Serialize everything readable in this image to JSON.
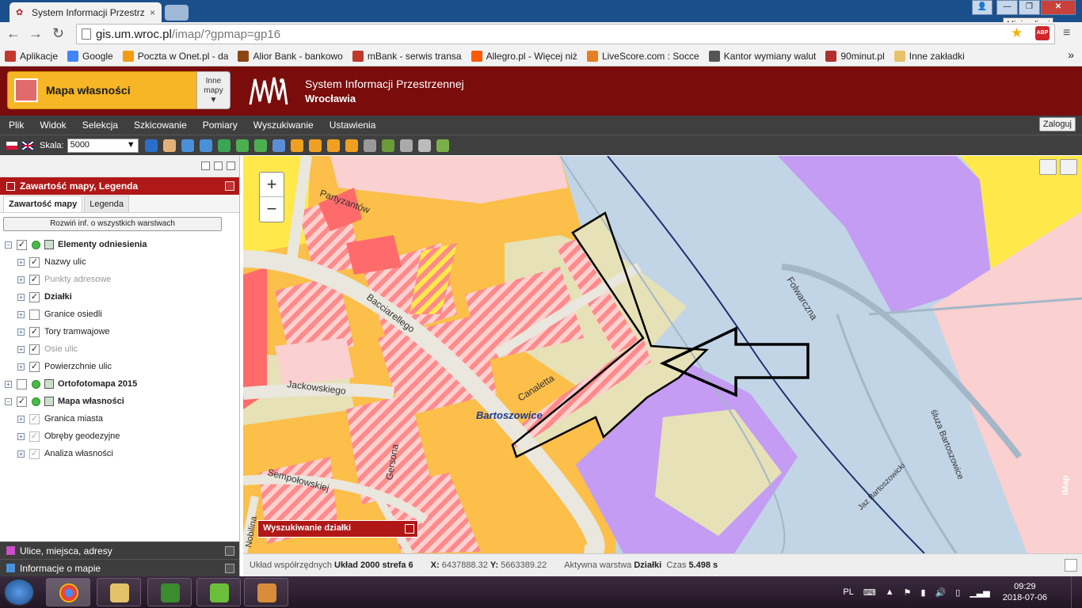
{
  "browser": {
    "tab_title": "System Informacji Przestrz",
    "tab_close": "×",
    "url_host": "gis.um.wroc.pl",
    "url_path": "/imap/?gpmap=gp16",
    "tooltip": "Minimalizuj",
    "abp": "ABP",
    "bookmarks": [
      {
        "label": "Aplikacje",
        "color": "#c0392b"
      },
      {
        "label": "Google",
        "color": "#4285f4"
      },
      {
        "label": "Poczta w Onet.pl - da",
        "color": "#f39c12"
      },
      {
        "label": "Alior Bank - bankowo",
        "color": "#8b4513"
      },
      {
        "label": "mBank - serwis transa",
        "color": "#c0392b"
      },
      {
        "label": "Allegro.pl - Więcej niż",
        "color": "#ff5a00"
      },
      {
        "label": "LiveScore.com : Socce",
        "color": "#e67e22"
      },
      {
        "label": "Kantor wymiany walut",
        "color": "#555555"
      },
      {
        "label": "90minut.pl",
        "color": "#b03030"
      },
      {
        "label": "Inne zakładki",
        "color": "#e8c16b"
      }
    ]
  },
  "header": {
    "map_name": "Mapa własności",
    "other_maps_1": "Inne",
    "other_maps_2": "mapy",
    "title_line1": "System Informacji Przestrzennej",
    "title_line2": "Wrocławia"
  },
  "menu": {
    "items": [
      "Plik",
      "Widok",
      "Selekcja",
      "Szkicowanie",
      "Pomiary",
      "Wyszukiwanie",
      "Ustawienia"
    ],
    "login": "Zaloguj"
  },
  "toolbar": {
    "scale_label": "Skala:",
    "scale_value": "5000",
    "scale_arrow": "▼",
    "icons": [
      {
        "name": "info-icon",
        "color": "#2a6fc9"
      },
      {
        "name": "pan-hand-icon",
        "color": "#e3b27a"
      },
      {
        "name": "zoom-in-icon",
        "color": "#4a90d9"
      },
      {
        "name": "zoom-out-icon",
        "color": "#4a90d9"
      },
      {
        "name": "globe-icon",
        "color": "#3aa655"
      },
      {
        "name": "back-arrow-icon",
        "color": "#4caf50"
      },
      {
        "name": "forward-arrow-icon",
        "color": "#4caf50"
      },
      {
        "name": "zoom-box-icon",
        "color": "#5b8ed6"
      },
      {
        "name": "pencil-icon",
        "color": "#f0a020"
      },
      {
        "name": "measure-line-icon",
        "color": "#f0a020"
      },
      {
        "name": "measure-area-icon",
        "color": "#f0a020"
      },
      {
        "name": "crop-icon",
        "color": "#f0a020"
      },
      {
        "name": "layers-icon",
        "color": "#999999"
      },
      {
        "name": "wfs-icon",
        "color": "#6a9a3a"
      },
      {
        "name": "print-icon",
        "color": "#aaaaaa"
      },
      {
        "name": "link-icon",
        "color": "#bbbbbb"
      },
      {
        "name": "image-export-icon",
        "color": "#7ab04a"
      }
    ]
  },
  "left_panel": {
    "section_title": "Zawartość mapy, Legenda",
    "tabs": [
      "Zawartość mapy",
      "Legenda"
    ],
    "expand_all": "Rozwiń inf. o wszystkich warstwach",
    "layers": [
      {
        "label": "Elementy odniesienia",
        "level": 0,
        "checked": true,
        "bold": true,
        "dot": true,
        "icon": true,
        "dim": false,
        "pm": "−"
      },
      {
        "label": "Nazwy ulic",
        "level": 1,
        "checked": true,
        "bold": false,
        "dot": false,
        "icon": false,
        "dim": false,
        "pm": "+"
      },
      {
        "label": "Punkty adresowe",
        "level": 1,
        "checked": true,
        "bold": false,
        "dot": false,
        "icon": false,
        "dim": true,
        "pm": "+"
      },
      {
        "label": "Działki",
        "level": 1,
        "checked": true,
        "bold": true,
        "dot": false,
        "icon": false,
        "dim": false,
        "pm": "+"
      },
      {
        "label": "Granice osiedli",
        "level": 1,
        "checked": false,
        "bold": false,
        "dot": false,
        "icon": false,
        "dim": false,
        "pm": "+"
      },
      {
        "label": "Tory tramwajowe",
        "level": 1,
        "checked": true,
        "bold": false,
        "dot": false,
        "icon": false,
        "dim": false,
        "pm": "+"
      },
      {
        "label": "Osie ulic",
        "level": 1,
        "checked": true,
        "bold": false,
        "dot": false,
        "icon": false,
        "dim": true,
        "pm": "+"
      },
      {
        "label": "Powierzchnie ulic",
        "level": 1,
        "checked": true,
        "bold": false,
        "dot": false,
        "icon": false,
        "dim": false,
        "pm": "+"
      },
      {
        "label": "Ortofotomapa 2015",
        "level": 0,
        "checked": false,
        "bold": true,
        "dot": true,
        "icon": true,
        "dim": false,
        "pm": "+"
      },
      {
        "label": "Mapa własności",
        "level": 0,
        "checked": true,
        "bold": true,
        "dot": true,
        "icon": true,
        "dim": false,
        "pm": "−"
      },
      {
        "label": "Granica miasta",
        "level": 1,
        "checked": true,
        "bold": false,
        "dot": false,
        "icon": false,
        "dim": false,
        "pm": "+",
        "disabled": true
      },
      {
        "label": "Obręby geodezyjne",
        "level": 1,
        "checked": true,
        "bold": false,
        "dot": false,
        "icon": false,
        "dim": false,
        "pm": "+",
        "disabled": true
      },
      {
        "label": "Analiza własności",
        "level": 1,
        "checked": true,
        "bold": false,
        "dot": false,
        "icon": false,
        "dim": false,
        "pm": "+",
        "disabled": true
      }
    ],
    "bottom_sections": [
      "Ulice, miejsca, adresy",
      "Informacje o mapie"
    ]
  },
  "map": {
    "zoom_in": "+",
    "zoom_out": "−",
    "search_panel": "Wyszukiwanie działki",
    "district_label": "Bartoszowice",
    "imap_logo": "iMap",
    "street_labels": [
      "Partyzantów",
      "Bacciarellego",
      "Canaletta",
      "Jackowskiego",
      "Sempołowskiej",
      "Gersona",
      "Folwarczna",
      "śluza Bartoszowice",
      "Jaz Bartoszowicki",
      "Nobilina"
    ]
  },
  "status": {
    "coord_label": "Układ współrzędnych",
    "coord_value": "Układ 2000 strefa 6",
    "x_label": "X:",
    "x_value": "6437888.32",
    "y_label": "Y:",
    "y_value": "5663389.22",
    "layer_label": "Aktywna warstwa",
    "layer_value": "Działki",
    "time_label": "Czas",
    "time_value": "5.498 s"
  },
  "taskbar": {
    "lang": "PL",
    "time": "09:29",
    "date": "2018-07-06"
  }
}
